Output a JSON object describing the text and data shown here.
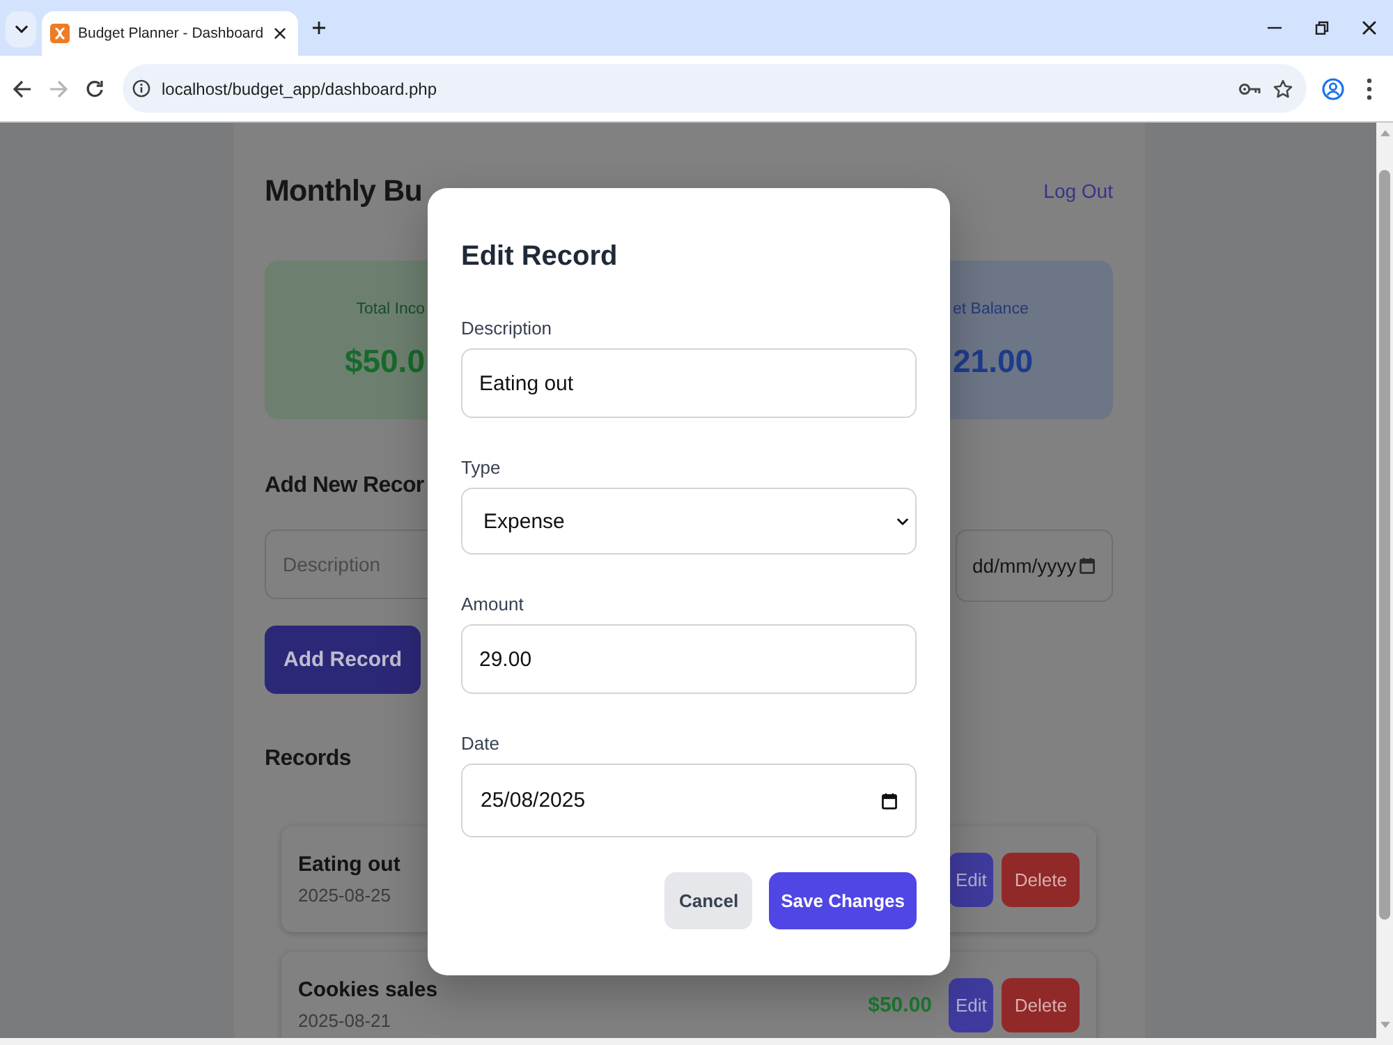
{
  "browser": {
    "tabs": [
      {
        "title": "Budget Planner - Dashboard",
        "selected": true
      }
    ],
    "nav": [
      {
        "kind": "back",
        "disabled": false
      },
      {
        "kind": "forward",
        "disabled": true
      },
      {
        "kind": "reload",
        "disabled": false
      }
    ],
    "url": "localhost/budget_app/dashboard.php"
  },
  "page": {
    "title": "Monthly Bu",
    "logout": "Log Out",
    "summary": [
      {
        "kind": "income",
        "label": "Total Inco",
        "amount": "$50.0"
      },
      {
        "kind": "balance",
        "label": "et Balance",
        "amount": "21.00"
      }
    ],
    "add_form": {
      "title": "Add New Recor",
      "fields": [
        {
          "kind": "text",
          "placeholder": "Description"
        },
        {
          "kind": "date",
          "placeholder": "dd/mm/yyyy"
        }
      ],
      "submit": "Add Record"
    },
    "records": {
      "title": "Records",
      "items": [
        {
          "description": "Eating out",
          "date": "2025-08-25",
          "actions": [
            {
              "kind": "edit",
              "label": "Edit"
            },
            {
              "kind": "delete",
              "label": "Delete"
            }
          ]
        },
        {
          "description": "Cookies sales",
          "date": "2025-08-21",
          "amount": "$50.00",
          "color": "#1b7a30",
          "actions": [
            {
              "kind": "edit",
              "label": "Edit"
            },
            {
              "kind": "delete",
              "label": "Delete"
            }
          ]
        }
      ]
    }
  },
  "modal": {
    "title": "Edit Record",
    "fields": [
      {
        "label": "Description",
        "kind": "text",
        "value": "Eating out"
      },
      {
        "label": "Type",
        "kind": "select",
        "value": "Expense"
      },
      {
        "label": "Amount",
        "kind": "text",
        "value": "29.00"
      },
      {
        "label": "Date",
        "kind": "date",
        "value": "25/08/2025"
      }
    ],
    "buttons": [
      {
        "kind": "secondary",
        "label": "Cancel"
      },
      {
        "kind": "primary",
        "label": "Save Changes"
      }
    ]
  }
}
